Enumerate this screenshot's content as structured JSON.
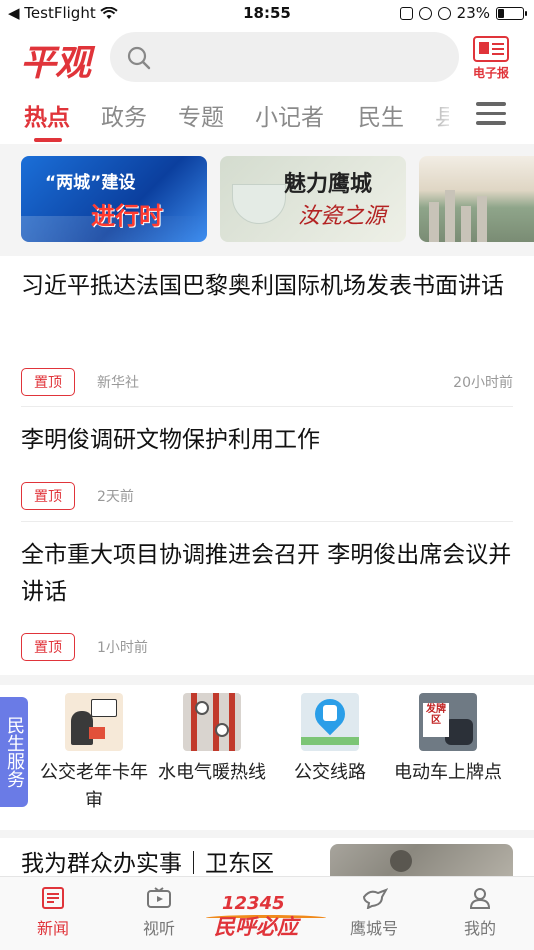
{
  "status_bar": {
    "carrier": "◀ TestFlight",
    "time": "18:55",
    "battery_text": "23%",
    "battery_level": 0.23
  },
  "header": {
    "logo": "平观",
    "search_placeholder": "",
    "epaper_label": "电子报"
  },
  "tabs": [
    {
      "label": "热点",
      "active": true
    },
    {
      "label": "政务",
      "active": false
    },
    {
      "label": "专题",
      "active": false
    },
    {
      "label": "小记者",
      "active": false
    },
    {
      "label": "民生",
      "active": false
    },
    {
      "label": "县",
      "active": false
    }
  ],
  "banners": [
    {
      "line1": "“两城”建设",
      "line2": "进行时"
    },
    {
      "line1": "魅力鹰城",
      "line2": "汝瓷之源"
    },
    {
      "line1": ""
    }
  ],
  "articles": [
    {
      "title": "习近平抵达法国巴黎奥利国际机场发表书面讲话",
      "badge": "置顶",
      "source": "新华社",
      "time": "20小时前"
    },
    {
      "title": "李明俊调研文物保护利用工作",
      "badge": "置顶",
      "source": "",
      "time": "2天前"
    },
    {
      "title": "全市重大项目协调推进会召开 李明俊出席会议并讲话",
      "badge": "置顶",
      "source": "",
      "time": "1小时前"
    }
  ],
  "services": {
    "tab_label": "民生服务",
    "items": [
      {
        "name": "公交老年卡年审",
        "icon": "elderly-card-icon"
      },
      {
        "name": "水电气暖热线",
        "icon": "utilities-icon"
      },
      {
        "name": "公交线路",
        "icon": "bus-route-icon"
      },
      {
        "name": "电动车上牌点",
        "icon": "ebike-plate-icon"
      }
    ],
    "card_sign": "发牌区"
  },
  "bottom_article": {
    "title": "我为群众办实事｜卫东区"
  },
  "bottom_nav": {
    "items": [
      {
        "label": "新闻",
        "active": true,
        "icon": "news-icon"
      },
      {
        "label": "视听",
        "active": false,
        "icon": "tv-icon"
      },
      {
        "label": "鹰城号",
        "active": false,
        "icon": "bird-icon"
      },
      {
        "label": "我的",
        "active": false,
        "icon": "user-icon"
      }
    ],
    "center_logo": {
      "line1": "12345",
      "line2": "民呼必应"
    }
  },
  "colors": {
    "accent": "#e0343a",
    "service_tab": "#6a7be6"
  }
}
